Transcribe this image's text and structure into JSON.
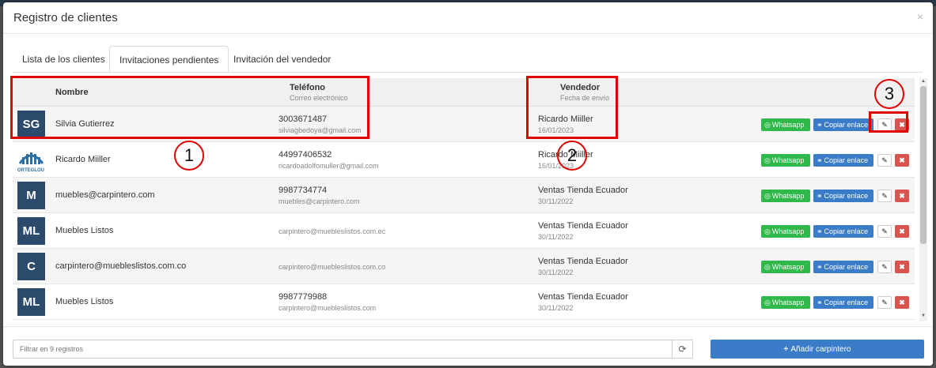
{
  "modal": {
    "title": "Registro de clientes",
    "close": "×"
  },
  "tabs": [
    {
      "label": "Lista de los clientes"
    },
    {
      "label": "Invitaciones pendientes",
      "active": true
    },
    {
      "label": "Invitación del vendedor"
    }
  ],
  "table": {
    "headers": {
      "name": "Nombre",
      "phone": "Teléfono",
      "phone_sub": "Correo electrónico",
      "vendor": "Vendedor",
      "vendor_sub": "Fecha de envío"
    },
    "rows": [
      {
        "initials": "SG",
        "name": "Silvia Gutierrez",
        "phone": "3003671487",
        "email": "silviagbedoya@gmail.com",
        "vendor": "Ricardo Miiller",
        "date": "16/01/2023"
      },
      {
        "initials": "",
        "logo_text": "ORTEGLOU",
        "name": "Ricardo Miiller",
        "phone": "44997406532",
        "email": "ricardoadolfomuller@gmail.com",
        "vendor": "Ricardo Miiller",
        "date": "16/01/2023"
      },
      {
        "initials": "M",
        "name": "muebles@carpintero.com",
        "phone": "9987734774",
        "email": "muebles@carpintero.com",
        "vendor": "Ventas Tienda Ecuador",
        "date": "30/11/2022"
      },
      {
        "initials": "ML",
        "name": "Muebles Listos",
        "phone": "",
        "email": "carpintero@muebleslistos.com.ec",
        "vendor": "Ventas Tienda Ecuador",
        "date": "30/11/2022"
      },
      {
        "initials": "C",
        "name": "carpintero@muebleslistos.com.co",
        "phone": "",
        "email": "carpintero@muebleslistos.com.co",
        "vendor": "Ventas Tienda Ecuador",
        "date": "30/11/2022"
      },
      {
        "initials": "ML",
        "name": "Muebles Listos",
        "phone": "9987779988",
        "email": "carpintero@muebleslistos.com",
        "vendor": "Ventas Tienda Ecuador",
        "date": "30/11/2022"
      }
    ],
    "actions": {
      "whatsapp": "Whatsapp",
      "copy": "Copiar enlace",
      "edit": "✎",
      "delete": "✖"
    }
  },
  "footer": {
    "filter_placeholder": "Filtrar en 9 registros",
    "refresh": "⟳",
    "add_label": "Añadir carpintero",
    "add_icon": "+"
  },
  "annotations": [
    "1",
    "2",
    "3"
  ],
  "colors": {
    "avatar": "#2c4a6b",
    "whatsapp": "#2fb94a",
    "copy": "#3a7cc8",
    "delete": "#d9534f",
    "annotation": "#e00000"
  }
}
